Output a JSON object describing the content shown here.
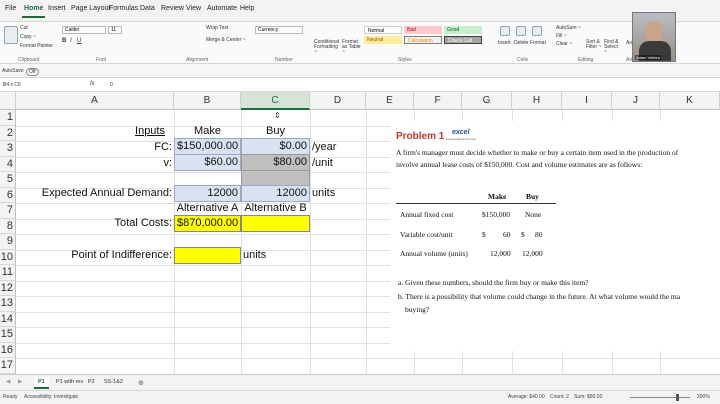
{
  "ribbon_tabs": [
    "File",
    "Home",
    "Insert",
    "Page Layout",
    "Formulas",
    "Data",
    "Review",
    "View",
    "Automate",
    "Help"
  ],
  "ribbon": {
    "clipboard": {
      "cut": "Cut",
      "copy": "Copy ~",
      "format_painter": "Format Painter",
      "label": "Clipboard"
    },
    "font": {
      "name": "Calibri",
      "size": "11",
      "label": "Font"
    },
    "alignment": {
      "wrap": "Wrap Text",
      "merge": "Merge & Center ~",
      "label": "Alignment"
    },
    "number": {
      "format": "Currency",
      "label": "Number"
    },
    "styles": {
      "normal": "Normal",
      "bad": "Bad",
      "good": "Good",
      "neutral": "Neutral",
      "calculation": "Calculation",
      "check_cell": "Check Cell",
      "conditional": "Conditional Formatting ~",
      "format_as_table": "Format as Table ~",
      "label": "Styles"
    },
    "cells": {
      "insert": "Insert",
      "delete": "Delete",
      "format": "Format",
      "label": "Cells"
    },
    "editing": {
      "autosum": "AutoSum ~",
      "fill": "Fill ~",
      "clear": "Clear ~",
      "sort": "Sort & Filter ~",
      "find": "Find & Select ~",
      "label": "Editing"
    },
    "analysis": {
      "analyze": "Analyze Data",
      "label": "Analysis"
    }
  },
  "qat": {
    "autosave": "AutoSave",
    "toggle": "Off"
  },
  "formula_bar": {
    "name_box": "B4 x C6",
    "fx": "fx",
    "value": "0"
  },
  "columns": [
    "A",
    "B",
    "C",
    "D",
    "E",
    "F",
    "G",
    "H",
    "I",
    "J",
    "K"
  ],
  "rows": [
    "1",
    "2",
    "3",
    "4",
    "5",
    "6",
    "7",
    "8",
    "9",
    "10",
    "11",
    "12",
    "13",
    "14",
    "15",
    "16",
    "17"
  ],
  "sheet": {
    "inputs": "Inputs",
    "make": "Make",
    "buy": "Buy",
    "fc_label": "FC:",
    "fc_make": "$150,000.00",
    "fc_buy": "$0.00",
    "fc_unit": "/year",
    "v_label": "v:",
    "v_make": "$60.00",
    "v_buy": "$80.00",
    "v_unit": "/unit",
    "demand_label": "Expected Annual Demand:",
    "demand_make": "12000",
    "demand_buy": "12000",
    "demand_unit": "units",
    "alt_a": "Alternative A",
    "alt_b": "Alternative B",
    "total_label": "Total Costs:",
    "total_make": "$870,000.00",
    "poi_label": "Point of Indifference:",
    "poi_unit": "units"
  },
  "problem": {
    "title": "Problem 1",
    "logo": "excel",
    "logo_sub": "www.excelnomics.com",
    "line1": "A firm's manager must decide whether to make or buy a certain item used in the production of",
    "line2": "involve annual lease costs of $150,000. Cost and volume estimates are as follows:",
    "head_make": "Make",
    "head_buy": "Buy",
    "r1_label": "Annual fixed cost",
    "r1_make": "$150,000",
    "r1_buy": "None",
    "r2_label": "Variable cost/unit",
    "r2_make_sym": "$",
    "r2_make": "60",
    "r2_buy_sym": "$",
    "r2_buy": "80",
    "r3_label": "Annual volume (units)",
    "r3_make": "12,000",
    "r3_buy": "12,000",
    "qa": "a.  Given these numbers, should the firm buy or make this item?",
    "qb1": "b.  There is a possibility that volume could change in the future. At what volume would the ma",
    "qb2": "buying?"
  },
  "sheet_tabs": [
    "P1",
    "P1 with rev",
    "P2",
    "SS-1&2"
  ],
  "status": {
    "ready": "Ready",
    "accessibility": "Accessibility: Investigate",
    "average": "Average: $40.00",
    "count": "Count: 2",
    "sum": "Sum: $80.00",
    "zoom": "200%"
  },
  "webcam_caption": "Adam Videira",
  "colors": {
    "accent": "#1f6b3a",
    "input_fill": "#d9e1f2",
    "gray_fill": "#bfbfbf",
    "yellow_fill": "#ffff00",
    "problem_title": "#c0392b"
  }
}
